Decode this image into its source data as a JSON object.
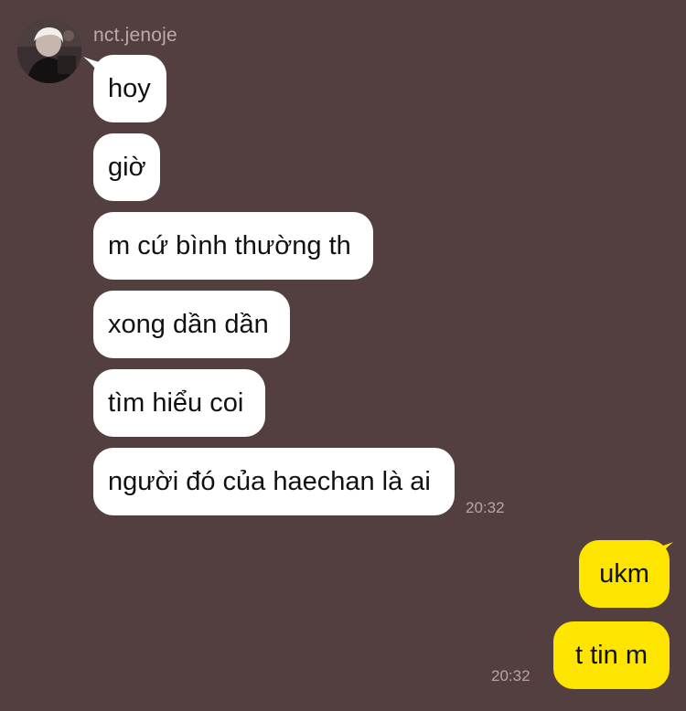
{
  "chat": {
    "sender_name": "nct.jenoje",
    "incoming": [
      {
        "text": "hoy"
      },
      {
        "text": "giờ"
      },
      {
        "text": "m cứ bình thường th"
      },
      {
        "text": "xong dần dần"
      },
      {
        "text": "tìm hiểu coi"
      },
      {
        "text": "người đó của haechan là ai"
      }
    ],
    "incoming_time": "20:32",
    "outgoing": [
      {
        "text": "ukm"
      },
      {
        "text": "t tin m"
      }
    ],
    "outgoing_time": "20:32"
  },
  "colors": {
    "background": "#543f40",
    "incoming_bubble": "#ffffff",
    "outgoing_bubble": "#fee500",
    "meta_text": "#b3a6a6"
  },
  "icons": {
    "avatar": "profile-photo"
  }
}
